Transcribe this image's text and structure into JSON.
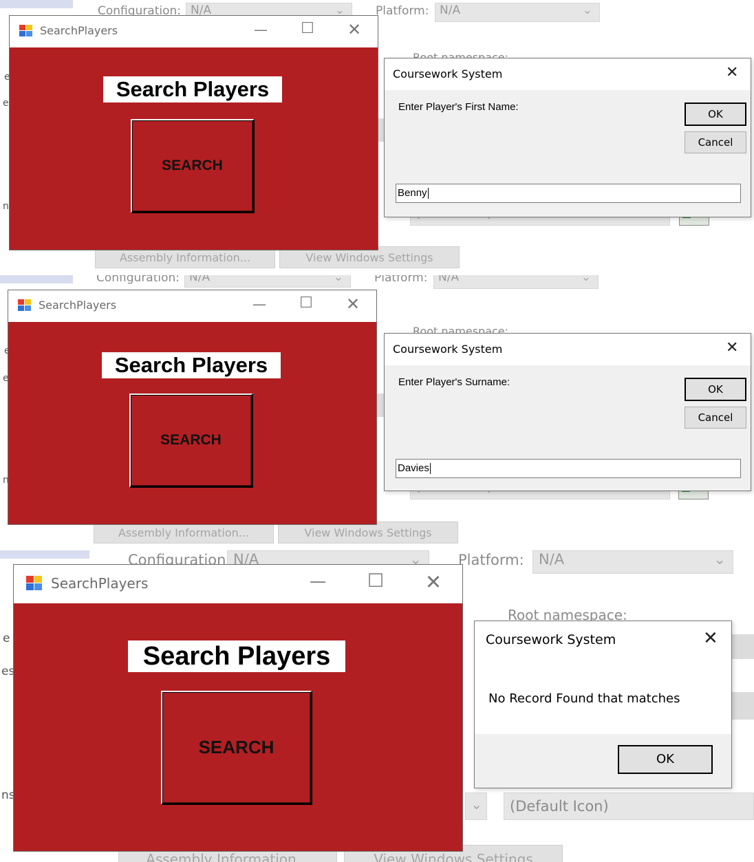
{
  "background": {
    "configuration_label": "Configuration:",
    "configuration_value": "N/A",
    "platform_label": "Platform:",
    "platform_value": "N/A",
    "root_namespace_label": "Root namespace:",
    "icon_value": "(Default Icon)",
    "assembly_button": "Assembly Information...",
    "view_settings_button": "View Windows Settings",
    "edge_chars": [
      "e",
      "es",
      "ns"
    ]
  },
  "search_window": {
    "title": "SearchPlayers",
    "heading": "Search Players",
    "search_button": "SEARCH",
    "colors": {
      "form_bg": "#b21f22"
    }
  },
  "panels": [
    {
      "dialog": {
        "title": "Coursework System",
        "prompt": "Enter Player's First Name:",
        "ok": "OK",
        "cancel": "Cancel",
        "input_value": "Benny"
      }
    },
    {
      "dialog": {
        "title": "Coursework System",
        "prompt": "Enter Player's Surname:",
        "ok": "OK",
        "cancel": "Cancel",
        "input_value": "Davies"
      }
    },
    {
      "dialog": {
        "title": "Coursework System",
        "message": "No Record Found that matches",
        "ok": "OK"
      }
    }
  ]
}
